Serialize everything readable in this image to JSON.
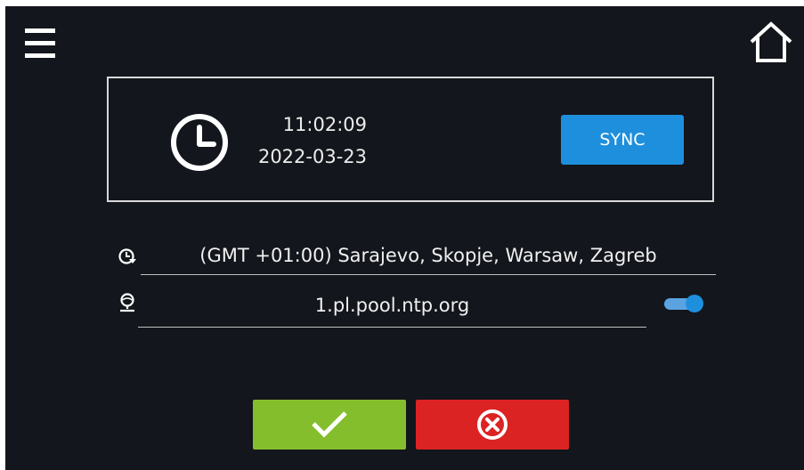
{
  "header": {
    "menu_icon": "hamburger-menu-icon",
    "home_icon": "home-icon"
  },
  "clock_panel": {
    "icon": "clock-icon",
    "time": "11:02:09",
    "date": "2022-03-23",
    "sync_label": "SYNC"
  },
  "timezone": {
    "icon": "timezone-icon",
    "value": "(GMT +01:00) Sarajevo, Skopje, Warsaw, Zagreb"
  },
  "ntp": {
    "icon": "ntp-server-icon",
    "server": "1.pl.pool.ntp.org",
    "enabled": true
  },
  "actions": {
    "confirm_icon": "checkmark-icon",
    "cancel_icon": "cancel-x-icon"
  },
  "colors": {
    "background": "#13161c",
    "accent": "#1e8fdc",
    "confirm": "#85be2d",
    "cancel": "#dc2323"
  }
}
